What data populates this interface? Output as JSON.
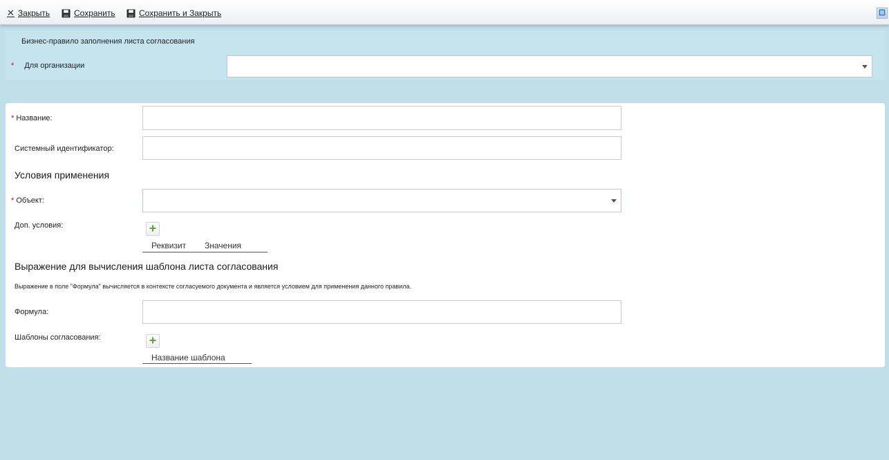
{
  "toolbar": {
    "close_label": "Закрыть",
    "save_label": "Сохранить",
    "save_close_label": "Сохранить и Закрыть"
  },
  "header": {
    "title": "Бизнес-правило заполнения листа согласования",
    "org_required_mark": "*",
    "org_label": "Для организации",
    "org_value": ""
  },
  "form": {
    "name_required_mark": "*",
    "name_label": "Название:",
    "name_value": "",
    "sysid_label": "Системный идентификатор:",
    "sysid_value": "",
    "conditions_title": "Условия применения",
    "object_required_mark": "*",
    "object_label": "Объект:",
    "object_value": "",
    "extra_label": "Доп. условия:",
    "extra_columns": [
      "Реквизит",
      "Значения"
    ],
    "expression_title": "Выражение для вычисления шаблона листа согласования",
    "expression_note": "Выражение в поле \"Формула\" вычисляется в контексте согласуемого документа и является условием для применения данного правила.",
    "formula_label": "Формула:",
    "formula_value": "",
    "templates_label": "Шаблоны согласования:",
    "templates_columns": [
      "Название шаблона"
    ]
  },
  "colors": {
    "background": "#c0dfe9",
    "required": "#dd0000",
    "add_icon": "#5aa83a"
  },
  "icons": {
    "close": "close-icon",
    "save": "floppy-disk-icon",
    "save_close": "floppy-disk-icon",
    "window": "window-icon",
    "add": "plus-icon",
    "dropdown": "chevron-down-icon"
  }
}
